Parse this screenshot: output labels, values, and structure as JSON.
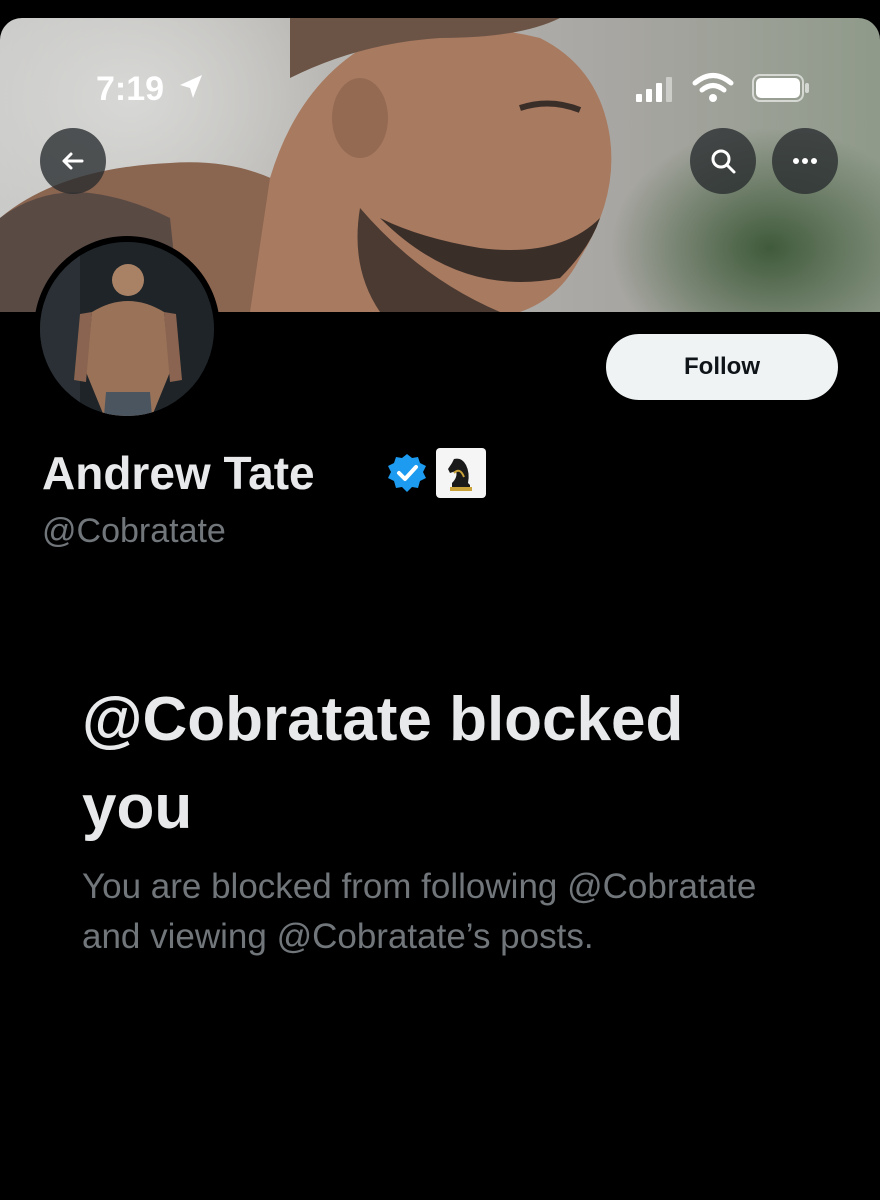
{
  "status_bar": {
    "time": "7:19",
    "icons": [
      "location-arrow-icon",
      "cellular-signal-icon",
      "wifi-icon",
      "battery-icon"
    ]
  },
  "header": {
    "back_icon": "back-arrow-icon",
    "search_icon": "search-icon",
    "more_icon": "more-options-icon"
  },
  "profile": {
    "display_name": "Andrew Tate",
    "handle": "@Cobratate",
    "verified_color": "#1d9bf0",
    "affiliate_badge_icon": "chess-knight-icon",
    "follow_label": "Follow"
  },
  "blocked": {
    "title": "@Cobratate blocked you",
    "description": "You are blocked from following @Cobratate and viewing @Cobratate’s posts."
  },
  "colors": {
    "background": "#000000",
    "primary_text": "#e7e9ea",
    "secondary_text": "#71767b",
    "follow_button_bg": "#eff3f4"
  }
}
